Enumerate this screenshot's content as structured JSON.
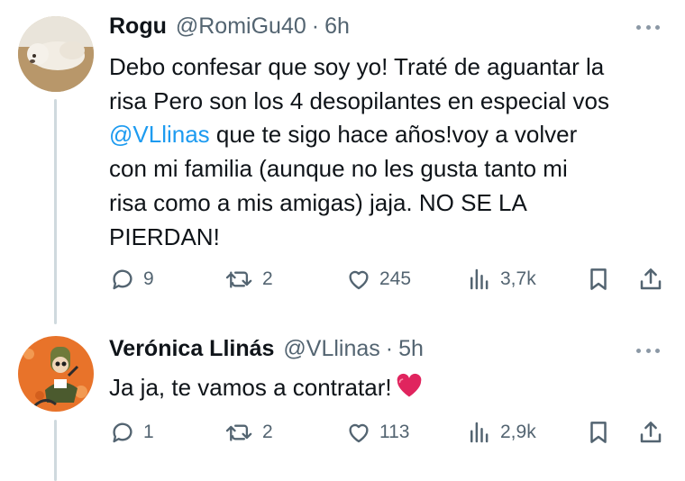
{
  "tweets": [
    {
      "name": "Rogu",
      "handle": "@RomiGu40",
      "separator": "·",
      "time": "6h",
      "avatar_icon": "dog-avatar",
      "text_lines": [
        "Debo confesar que soy yo! Traté de aguantar la",
        "risa Pero son los 4 desopilantes en especial vos",
        "que te sigo hace años!voy a volver",
        "con mi familia (aunque no les gusta tanto mi",
        "risa como a mis amigas) jaja. NO SE LA",
        "PIERDAN!"
      ],
      "mention": "@VLlinas",
      "stats": {
        "replies": "9",
        "reposts": "2",
        "likes": "245",
        "views": "3,7k"
      }
    },
    {
      "name": "Verónica Llinás",
      "handle": "@VLlinas",
      "separator": "·",
      "time": "5h",
      "avatar_icon": "illustrated-avatar",
      "text": "Ja ja, te vamos a contratar!",
      "emoji": "red-heart",
      "stats": {
        "replies": "1",
        "reposts": "2",
        "likes": "113",
        "views": "2,9k"
      }
    }
  ],
  "icons": {
    "reply": "reply-icon",
    "repost": "repost-icon",
    "like": "like-icon",
    "views": "views-icon",
    "bookmark": "bookmark-icon",
    "share": "share-icon",
    "more": "more-icon"
  },
  "colors": {
    "text": "#0f1419",
    "secondary": "#536471",
    "mention": "#1d9bf0",
    "thread_line": "#cfd9de",
    "heart": "#e0245e"
  }
}
